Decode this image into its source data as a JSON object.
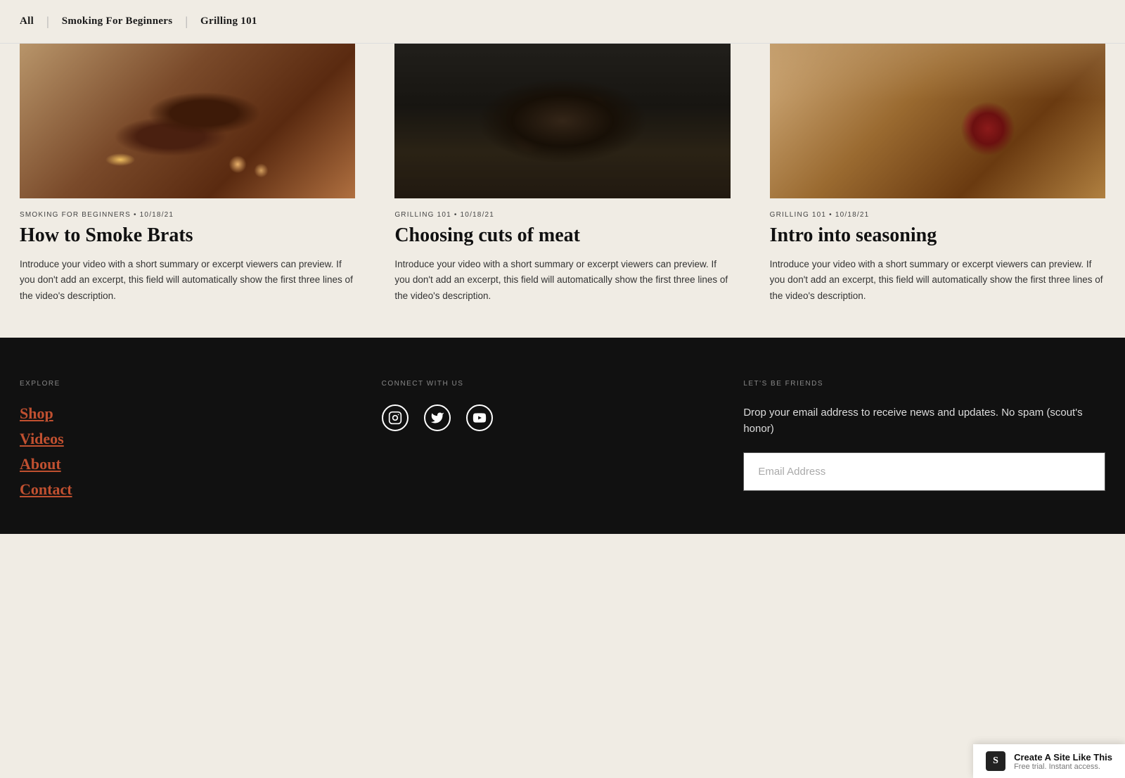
{
  "filter_nav": {
    "items": [
      {
        "label": "All",
        "active": true
      },
      {
        "label": "Smoking For Beginners",
        "active": false
      },
      {
        "label": "Grilling 101",
        "active": false
      }
    ],
    "separator": "|"
  },
  "videos": [
    {
      "category": "SMOKING FOR BEGINNERS",
      "date": "10/18/21",
      "title": "How to Smoke Brats",
      "excerpt": "Introduce your video with a short summary or excerpt viewers can preview. If you don't add an excerpt, this field will automatically show the first three lines of the video's description.",
      "image_type": "sausages"
    },
    {
      "category": "GRILLING 101",
      "date": "10/18/21",
      "title": "Choosing cuts of meat",
      "excerpt": "Introduce your video with a short summary or excerpt viewers can preview. If you don't add an excerpt, this field will automatically show the first three lines of the video's description.",
      "image_type": "grilling"
    },
    {
      "category": "GRILLING 101",
      "date": "10/18/21",
      "title": "Intro into seasoning",
      "excerpt": "Introduce your video with a short summary or excerpt viewers can preview. If you don't add an excerpt, this field will automatically show the first three lines of the video's description.",
      "image_type": "seasoning"
    }
  ],
  "footer": {
    "explore": {
      "label": "EXPLORE",
      "links": [
        "Shop",
        "Videos",
        "About",
        "Contact"
      ]
    },
    "connect": {
      "label": "CONNECT WITH US",
      "icons": [
        "instagram",
        "twitter",
        "youtube"
      ]
    },
    "friends": {
      "label": "LET'S BE FRIENDS",
      "description": "Drop your email address to receive news and updates. No spam (scout's honor)",
      "email_placeholder": "Email Address"
    }
  },
  "ss_banner": {
    "logo": "S",
    "main_text": "Create A Site Like This",
    "sub_text": "Free trial. Instant access."
  }
}
